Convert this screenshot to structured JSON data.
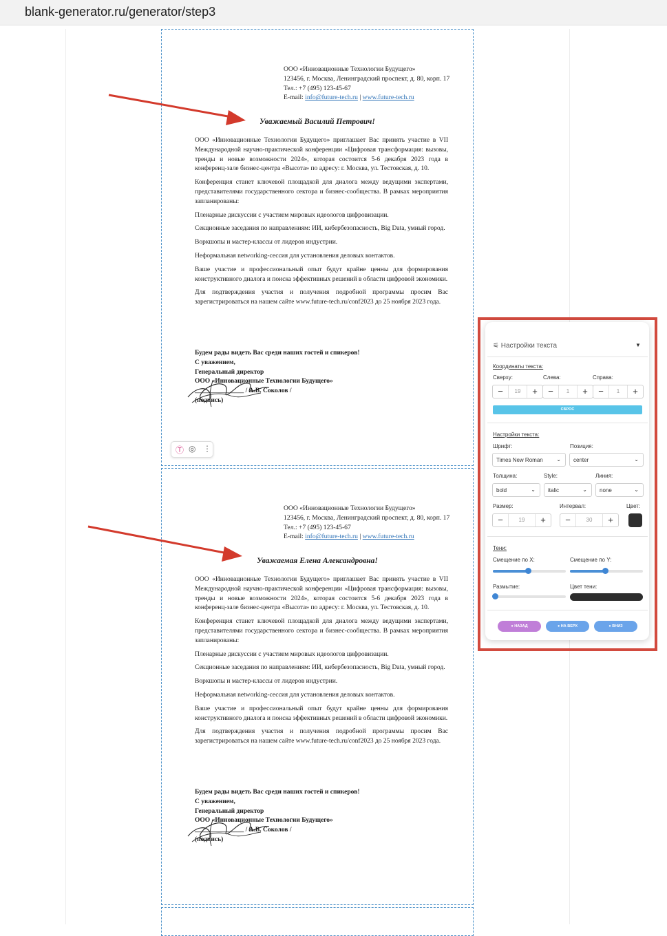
{
  "browser": {
    "url": "blank-generator.ru/generator/step3"
  },
  "letters": [
    {
      "company": "ООО «Инновационные Технологии Будущего»",
      "address": "123456, г. Москва, Ленинградский проспект, д. 80, корп. 17",
      "phone": "Тел.: +7 (495) 123-45-67",
      "email_label": "E-mail: ",
      "email": "info@future-tech.ru",
      "separator": " | ",
      "website": "www.future-tech.ru",
      "greeting": "Уважаемый Василий Петрович!"
    },
    {
      "company": "ООО «Инновационные Технологии Будущего»",
      "address": "123456, г. Москва, Ленинградский проспект, д. 80, корп. 17",
      "phone": "Тел.: +7 (495) 123-45-67",
      "email_label": "E-mail: ",
      "email": "info@future-tech.ru",
      "separator": " | ",
      "website": "www.future-tech.ru",
      "greeting": "Уважаемая Елена Александровна!"
    }
  ],
  "body": {
    "p1": "ООО «Инновационные Технологии Будущего» приглашает Вас принять участие в VII Международной научно-практической конференции «Цифровая трансформация: вызовы, тренды и новые возможности 2024», которая состоится 5-6 декабря 2023 года в конференц-зале бизнес-центра «Высота» по адресу: г. Москва, ул. Тестовская, д. 10.",
    "p2": "Конференция станет ключевой площадкой для диалога между ведущими экспертами, представителями государственного сектора и бизнес-сообщества. В рамках мероприятия запланированы:",
    "p3": "Пленарные дискуссии с участием мировых идеологов цифровизации.",
    "p4": "Секционные заседания по направлениям: ИИ, кибербезопасность,  Big Data, умный город.",
    "p5": "Воркшопы и мастер-классы  от лидеров индустрии.",
    "p6": "Неформальная networking-сессия для установления деловых контактов.",
    "p7": "Ваше участие и профессиональный опыт будут крайне ценны для формирования конструктивного диалога и поиска эффективных решений в области цифровой экономики.",
    "p8": "Для подтверждения участия и получения подробной программы просим Вас зарегистрироваться на нашем сайте www.future-tech.ru/conf2023 до 25 ноября 2023 года."
  },
  "closing": {
    "line1": "Будем рады видеть Вас среди наших гостей и спикеров!",
    "line2": "С уважением,",
    "line3": "Генеральный директор",
    "line4": "ООО «Инновационные Технологии Будущего»",
    "line5": "_______________ / А.В. Соколов /",
    "line6": "(подпись)"
  },
  "panel": {
    "title": "Настройки текста",
    "coords_title": "Координаты текста:",
    "top_label": "Сверху:",
    "left_label": "Слева:",
    "right_label": "Справа:",
    "top_value": "19",
    "left_value": "1",
    "right_value": "1",
    "reset_label": "СБРОС",
    "text_settings_title": "Настройки текста:",
    "font_label": "Шрифт:",
    "font_value": "Times New Roman",
    "position_label": "Позиция:",
    "position_value": "center",
    "weight_label": "Толщина:",
    "weight_value": "bold",
    "style_label": "Style:",
    "style_value": "italic",
    "line_label": "Линия:",
    "line_value": "none",
    "size_label": "Размер:",
    "size_value": "19",
    "interval_label": "Интервал:",
    "interval_value": "30",
    "color_label": "Цвет:",
    "color_value": "#2e2e2e",
    "shadows_title": "Тени:",
    "shift_x_label": "Смещение по X:",
    "shift_y_label": "Смещение по Y:",
    "blur_label": "Размытие:",
    "shadow_color_label": "Цвет тени:",
    "shadow_color_value": "#2d2d2d",
    "back_label": "НАЗАД",
    "up_label": "НА ВЕРХ",
    "down_label": "ВНИЗ"
  },
  "colors": {
    "highlight": "#d24a3e",
    "accent": "#58c4e8",
    "back": "#c07ed8",
    "nav": "#6aa4ea"
  }
}
